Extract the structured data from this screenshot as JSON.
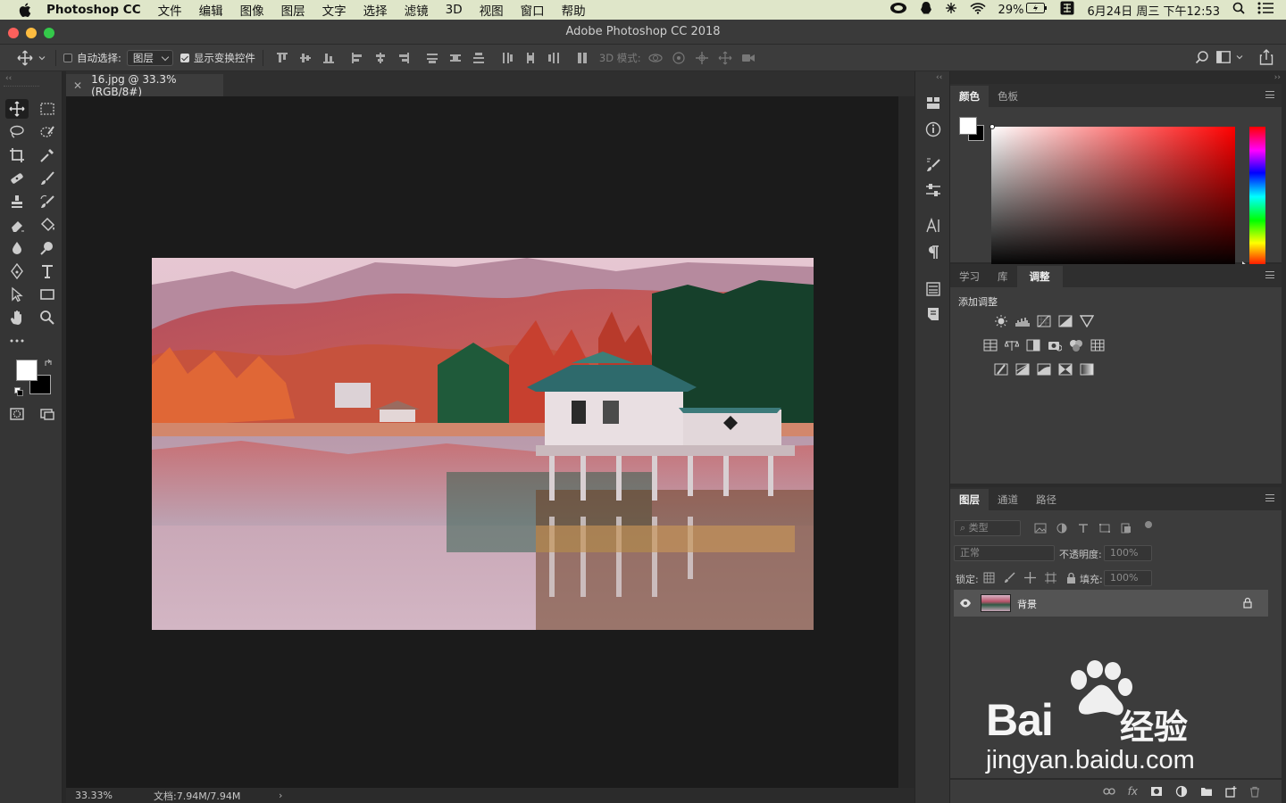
{
  "menubar": {
    "app_name": "Photoshop CC",
    "items": [
      "文件",
      "编辑",
      "图像",
      "图层",
      "文字",
      "选择",
      "滤镜",
      "3D",
      "视图",
      "窗口",
      "帮助"
    ],
    "battery": "29%",
    "datetime": "6月24日 周三 下午12:53"
  },
  "window": {
    "title": "Adobe Photoshop CC 2018"
  },
  "options": {
    "auto_select_label": "自动选择:",
    "auto_select_value": "图层",
    "show_transform_label": "显示变换控件",
    "mode_3d_label": "3D 模式:"
  },
  "document": {
    "tab_title": "16.jpg @ 33.3%(RGB/8#)",
    "zoom": "33.33%",
    "doc_size": "文档:7.94M/7.94M"
  },
  "color_panel": {
    "tabs": [
      "颜色",
      "色板"
    ],
    "active": "颜色",
    "foreground": "#ffffff",
    "background": "#000000"
  },
  "adjust_panel": {
    "tabs": [
      "学习",
      "库",
      "调整"
    ],
    "active": "调整",
    "heading": "添加调整"
  },
  "layers_panel": {
    "tabs": [
      "图层",
      "通道",
      "路径"
    ],
    "active": "图层",
    "filter_placeholder": "类型",
    "blend_mode": "正常",
    "opacity_label": "不透明度:",
    "opacity_value": "100%",
    "lock_label": "锁定:",
    "fill_label": "填充:",
    "fill_value": "100%",
    "layers": [
      {
        "name": "背景",
        "visible": true,
        "locked": true
      }
    ]
  },
  "watermark": {
    "brand": "Bai",
    "brand_cn": "经验",
    "url": "jingyan.baidu.com"
  },
  "colors": {
    "accent_menubar": "#dfe6c9",
    "panel_bg": "#3c3c3c",
    "canvas_bg": "#1b1b1b"
  }
}
